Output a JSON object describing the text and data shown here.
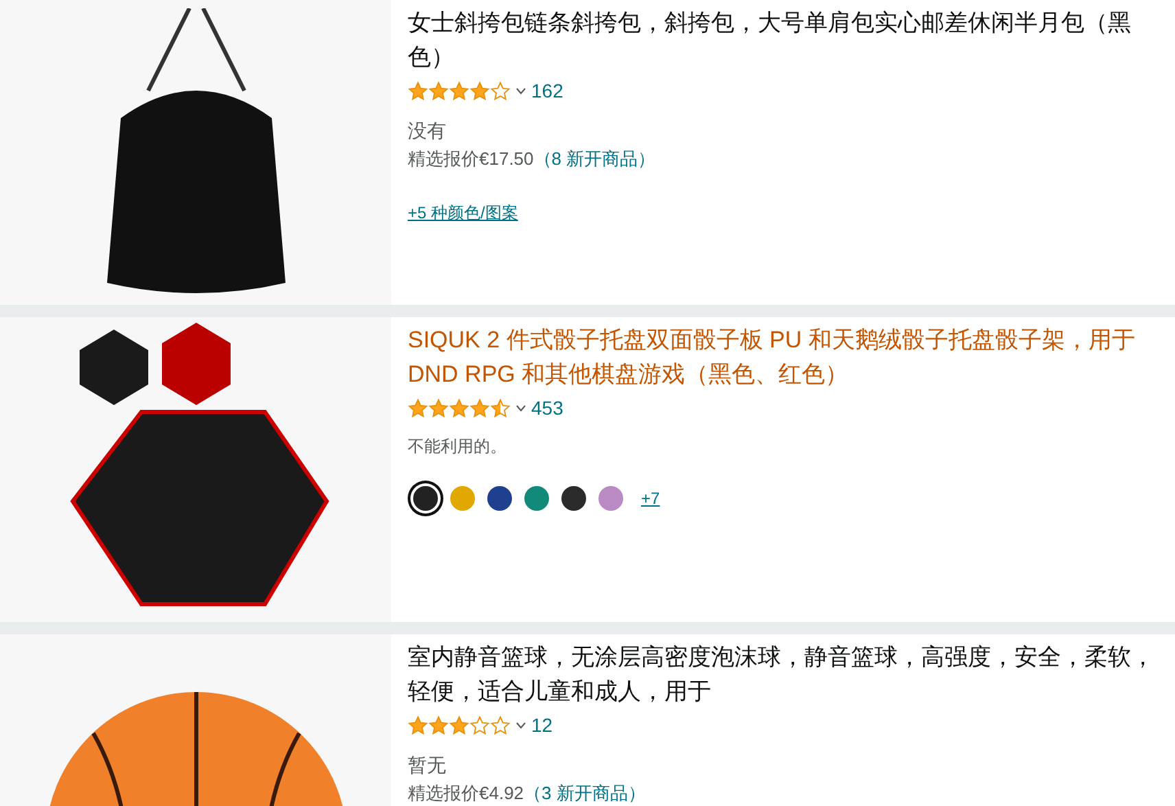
{
  "products": [
    {
      "kind": "bag",
      "title": "女士斜挎包链条斜挎包，斜挎包，大号单肩包实心邮差休闲半月包（黑色）",
      "highlighted": false,
      "stars": 4,
      "reviews": "162",
      "availability": "没有",
      "price_label": "精选报价€17.50",
      "offers": "（8 新开商品）",
      "variants_link": "+5 种颜色/图案"
    },
    {
      "kind": "tray",
      "title": "SIQUK 2 件式骰子托盘双面骰子板 PU 和天鹅绒骰子托盘骰子架，用于 DND RPG 和其他棋盘游戏（黑色、红色）",
      "highlighted": true,
      "stars": 4.5,
      "reviews": "453",
      "availability": "不能利用的。",
      "swatches": [
        {
          "color": "#222222",
          "selected": true
        },
        {
          "color": "#e0a800",
          "selected": false
        },
        {
          "color": "#1f3f8f",
          "selected": false
        },
        {
          "color": "#128a7a",
          "selected": false
        },
        {
          "color": "#2b2b2b",
          "selected": false
        },
        {
          "color": "#b98ac3",
          "selected": false
        }
      ],
      "more_swatches": "+7"
    },
    {
      "kind": "ball",
      "title": "室内静音篮球，无涂层高密度泡沫球，静音篮球，高强度，安全，柔软，轻便，适合儿童和成人，用于",
      "highlighted": false,
      "stars": 3,
      "reviews": "12",
      "availability": "暂无",
      "price_label": "精选报价€4.92",
      "offers": "（3 新开商品）"
    }
  ]
}
